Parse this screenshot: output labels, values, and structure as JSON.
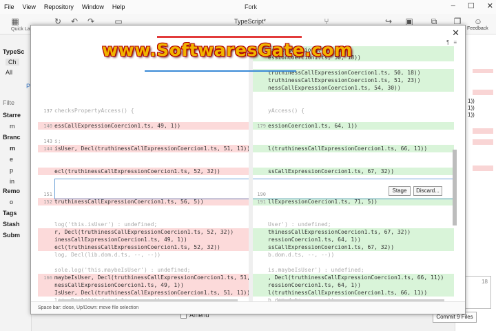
{
  "menu": [
    "File",
    "View",
    "Repository",
    "Window",
    "Help"
  ],
  "window_title": "Fork",
  "window_controls": [
    "–",
    "☐",
    "✕"
  ],
  "toolbar": {
    "quick_launch_label": "Quick La",
    "repo_name": "TypeScript*",
    "feedback_label": "Feedback"
  },
  "sidebar": {
    "items": [
      "TypeSc",
      "Ch",
      "All",
      "P",
      "Filte",
      "Starre",
      "m",
      "Branc",
      "m",
      "e",
      "p",
      "in",
      "Remo",
      "o",
      "Tags",
      "Stash",
      "Subm"
    ]
  },
  "modal": {
    "close_label": "✕",
    "top_icons": [
      "¶",
      "≡"
    ],
    "left_lines": [
      {
        "n": "",
        "t": "",
        "k": "ctx"
      },
      {
        "n": "",
        "t": "",
        "k": "ctx"
      },
      {
        "n": "",
        "t": "",
        "k": "ctx"
      },
      {
        "n": "",
        "t": "",
        "k": "ctx"
      },
      {
        "n": "",
        "t": "",
        "k": "ctx"
      },
      {
        "n": "",
        "t": "",
        "k": "ctx"
      },
      {
        "n": "",
        "t": "",
        "k": "ctx"
      },
      {
        "n": "",
        "t": "",
        "k": "ctx"
      },
      {
        "n": "137",
        "t": "checksPropertyAccess() {",
        "k": "ctx"
      },
      {
        "n": "",
        "t": "",
        "k": "ctx"
      },
      {
        "n": "140",
        "t": "essCallExpressionCoercion1.ts, 49, 1))",
        "k": "del"
      },
      {
        "n": "",
        "t": "",
        "k": "ctx"
      },
      {
        "n": "143",
        "t": "s;",
        "k": "ctx"
      },
      {
        "n": "144",
        "t": "isUser, Decl(truthinessCallExpressionCoercion1.ts, 51, 11))",
        "k": "del"
      },
      {
        "n": "",
        "t": "",
        "k": "ctx"
      },
      {
        "n": "",
        "t": "",
        "k": "ctx"
      },
      {
        "n": "",
        "t": "ecl(truthinessCallExpressionCoercion1.ts, 52, 32))",
        "k": "del"
      },
      {
        "n": "",
        "t": "",
        "k": "ctx"
      },
      {
        "n": "",
        "t": "",
        "k": "ctx"
      },
      {
        "n": "151",
        "t": "",
        "k": "ctx"
      },
      {
        "n": "152",
        "t": "truthinessCallExpressionCoercion1.ts, 56, 5))",
        "k": "del"
      },
      {
        "n": "",
        "t": "",
        "k": "ctx"
      },
      {
        "n": "",
        "t": "",
        "k": "ctx"
      },
      {
        "n": "",
        "t": "log('this.isUser') : undefined;",
        "k": "ctx"
      },
      {
        "n": "",
        "t": "r, Decl(truthinessCallExpressionCoercion1.ts, 52, 32))",
        "k": "del"
      },
      {
        "n": "",
        "t": "inessCallExpressionCoercion1.ts, 49, 1))",
        "k": "del"
      },
      {
        "n": "",
        "t": "ecl(truthinessCallExpressionCoercion1.ts, 52, 32))",
        "k": "del"
      },
      {
        "n": "",
        "t": "log, Decl(lib.dom.d.ts, --, --))",
        "k": "ctx"
      },
      {
        "n": "",
        "t": "",
        "k": "ctx"
      },
      {
        "n": "",
        "t": "sole.log('this.maybeIsUser') : undefined;",
        "k": "ctx"
      },
      {
        "n": "166",
        "t": "maybeIsUser, Decl(truthinessCallExpressionCoercion1.ts, 51, 11))",
        "k": "del"
      },
      {
        "n": "",
        "t": "nessCallExpressionCoercion1.ts, 49, 1))",
        "k": "del"
      },
      {
        "n": "",
        "t": "IsUser, Decl(truthinessCallExpressionCoercion1.ts, 51, 11))",
        "k": "del"
      },
      {
        "n": "",
        "t": "log, Decl(lib.dom.d.ts, --, --))",
        "k": "ctx"
      }
    ],
    "right_lines": [
      {
        "n": "",
        "t": "essionCoercion1.ts, 51, 2",
        "k": "add"
      },
      {
        "n": "",
        "t": "essionCoercion1.ts, 50, 18))",
        "k": "add"
      },
      {
        "n": "",
        "t": "",
        "k": "ctx"
      },
      {
        "n": "",
        "t": "truthinessCallExpressionCoercion1.ts, 50, 18))",
        "k": "add"
      },
      {
        "n": "",
        "t": "truthinessCallExpressionCoercion1.ts, 51, 23))",
        "k": "add"
      },
      {
        "n": "",
        "t": "nessCallExpressionCoercion1.ts, 54, 30))",
        "k": "add"
      },
      {
        "n": "",
        "t": "",
        "k": "ctx"
      },
      {
        "n": "",
        "t": "",
        "k": "ctx"
      },
      {
        "n": "",
        "t": "yAccess() {",
        "k": "ctx"
      },
      {
        "n": "",
        "t": "",
        "k": "ctx"
      },
      {
        "n": "179",
        "t": "essionCoercion1.ts, 64, 1))",
        "k": "add"
      },
      {
        "n": "",
        "t": "",
        "k": "ctx"
      },
      {
        "n": "",
        "t": "",
        "k": "ctx"
      },
      {
        "n": "",
        "t": "l(truthinessCallExpressionCoercion1.ts, 66, 11))",
        "k": "add"
      },
      {
        "n": "",
        "t": "",
        "k": "ctx"
      },
      {
        "n": "",
        "t": "",
        "k": "ctx"
      },
      {
        "n": "",
        "t": "ssCallExpressionCoercion1.ts, 67, 32))",
        "k": "add"
      },
      {
        "n": "",
        "t": "",
        "k": "ctx"
      },
      {
        "n": "",
        "t": "",
        "k": "ctx"
      },
      {
        "n": "190",
        "t": "",
        "k": "ctx"
      },
      {
        "n": "191",
        "t": "llExpressionCoercion1.ts, 71, 5))",
        "k": "add"
      },
      {
        "n": "",
        "t": "",
        "k": "ctx"
      },
      {
        "n": "",
        "t": "",
        "k": "ctx"
      },
      {
        "n": "",
        "t": "User') : undefined;",
        "k": "ctx"
      },
      {
        "n": "",
        "t": "thinessCallExpressionCoercion1.ts, 67, 32))",
        "k": "add"
      },
      {
        "n": "",
        "t": "ressionCoercion1.ts, 64, 1))",
        "k": "add"
      },
      {
        "n": "",
        "t": "ssCallExpressionCoercion1.ts, 67, 32))",
        "k": "add"
      },
      {
        "n": "",
        "t": "b.dom.d.ts, --, --))",
        "k": "ctx"
      },
      {
        "n": "",
        "t": "",
        "k": "ctx"
      },
      {
        "n": "",
        "t": "is.maybeIsUser') : undefined;",
        "k": "ctx"
      },
      {
        "n": "",
        "t": ", Decl(truthinessCallExpressionCoercion1.ts, 66, 11))",
        "k": "add"
      },
      {
        "n": "",
        "t": "ressionCoercion1.ts, 64, 1))",
        "k": "add"
      },
      {
        "n": "",
        "t": "l(truthinessCallExpressionCoercion1.ts, 66, 11))",
        "k": "add"
      },
      {
        "n": "",
        "t": "b.dom.d.ts, --, --))",
        "k": "ctx"
      }
    ],
    "stage_label": "Stage",
    "discard_label": "Discard...",
    "status_text": "Space bar: close, Up/Down: move file selection"
  },
  "right_panel": {
    "snippets": [
      "1))",
      "1))",
      "1))"
    ],
    "box_value": "18"
  },
  "bottom": {
    "amend_label": "Amend",
    "commit_label": "Commit 9 Files"
  },
  "watermark": "www.SoftwaresGate.com",
  "colors": {
    "deleted_bg": "#fcdada",
    "added_bg": "#d9f4d9",
    "watermark_fill": "#f0b400",
    "watermark_outline": "#b30000",
    "selection_border": "#6aa0d6"
  }
}
